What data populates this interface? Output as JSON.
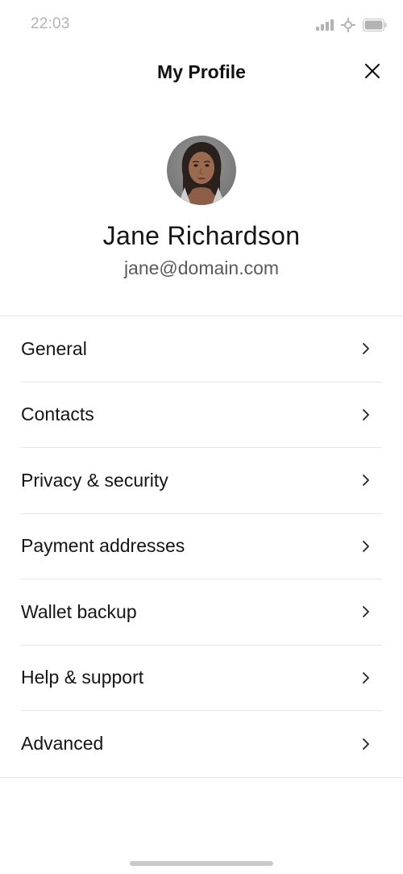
{
  "status_bar": {
    "time": "22:03",
    "icons": [
      "signal-icon",
      "network-icon",
      "battery-icon"
    ]
  },
  "header": {
    "title": "My Profile",
    "close_icon": "close-icon"
  },
  "profile": {
    "name": "Jane Richardson",
    "email": "jane@domain.com",
    "avatar_icon": "avatar"
  },
  "menu": {
    "items": [
      {
        "label": "General"
      },
      {
        "label": "Contacts"
      },
      {
        "label": "Privacy & security"
      },
      {
        "label": "Payment addresses"
      },
      {
        "label": "Wallet backup"
      },
      {
        "label": "Help & support"
      },
      {
        "label": "Advanced"
      }
    ],
    "chevron_icon": "chevron-right-icon"
  },
  "colors": {
    "text_primary": "#111111",
    "text_secondary": "#5a5a5a",
    "divider": "#e3e3e3",
    "status_gray": "#b3b3b3"
  }
}
